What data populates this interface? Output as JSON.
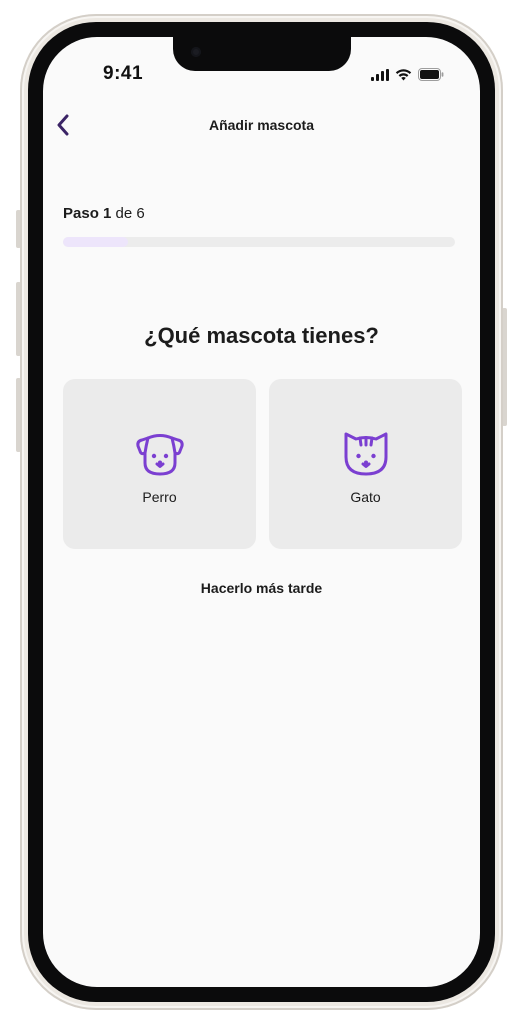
{
  "status_bar": {
    "time": "9:41",
    "icons": [
      "signal-icon",
      "wifi-icon",
      "battery-icon"
    ]
  },
  "nav": {
    "back_icon": "chevron-left-icon",
    "title": "Añadir mascota"
  },
  "progress": {
    "step_prefix": "Paso",
    "current_step": "1",
    "step_suffix": "de 6",
    "fraction": 0.1667,
    "fill_color": "#ede5fb",
    "track_color": "#ececec"
  },
  "question": "¿Qué mascota tienes?",
  "options": [
    {
      "label": "Perro",
      "icon": "dog-icon"
    },
    {
      "label": "Gato",
      "icon": "cat-icon"
    }
  ],
  "skip_label": "Hacerlo más tarde",
  "colors": {
    "accent": "#7b3fd1",
    "back_arrow": "#3b2466",
    "card_bg": "#ebebeb",
    "screen_bg": "#fafafa"
  }
}
